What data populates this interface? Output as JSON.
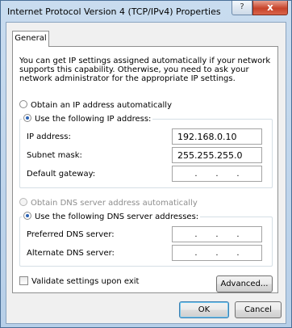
{
  "window": {
    "title": "Internet Protocol Version 4 (TCP/IPv4) Properties",
    "help_glyph": "?",
    "close_glyph": "x"
  },
  "tabs": [
    {
      "label": "General",
      "selected": true
    }
  ],
  "description": "You can get IP settings assigned automatically if your network supports this capability. Otherwise, you need to ask your network administrator for the appropriate IP settings.",
  "ip_section": {
    "auto_option": {
      "text": "Obtain an IP address automatically",
      "checked": false
    },
    "manual_option": {
      "text": "Use the following IP address:",
      "checked": true
    },
    "fields": [
      {
        "label": "IP address:",
        "value": "192.168.0.10"
      },
      {
        "label": "Subnet mask:",
        "value": "255.255.255.0"
      },
      {
        "label": "Default gateway:",
        "value": ""
      }
    ]
  },
  "dns_section": {
    "auto_option": {
      "text": "Obtain DNS server address automatically",
      "checked": false,
      "disabled": true
    },
    "manual_option": {
      "text": "Use the following DNS server addresses:",
      "checked": true
    },
    "fields": [
      {
        "label": "Preferred DNS server:",
        "value": ""
      },
      {
        "label": "Alternate DNS server:",
        "value": ""
      }
    ]
  },
  "validate_checkbox": {
    "text": "Validate settings upon exit",
    "checked": false
  },
  "buttons": {
    "advanced": "Advanced...",
    "ok": "OK",
    "cancel": "Cancel"
  },
  "colors": {
    "accent": "#2b63b5",
    "close": "#c7432a",
    "frame": "#b7cfe8"
  }
}
